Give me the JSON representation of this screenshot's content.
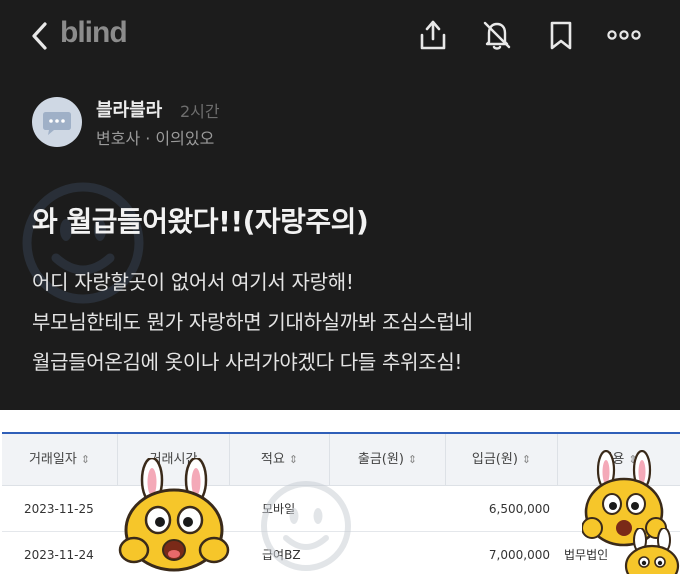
{
  "header": {
    "logo": "blind"
  },
  "post": {
    "author": "블라블라",
    "time": "2시간",
    "meta": "변호사 · 이의있오",
    "title": "와 월급들어왔다!!(자랑주의)",
    "body": [
      "어디 자랑할곳이 없어서 여기서 자랑해!",
      "부모님한테도 뭔가 자랑하면 기대하실까봐 조심스럽네",
      "월급들어온김에 옷이나 사러가야겠다 다들 추위조심!"
    ]
  },
  "table": {
    "headers": [
      "거래일자",
      "거래시간",
      "적요",
      "출금(원)",
      "입금(원)",
      "내용"
    ],
    "rows": [
      {
        "date": "2023-11-25",
        "desc": "모바일",
        "deposit": "6,500,000",
        "content": ""
      },
      {
        "date": "2023-11-24",
        "desc": "급여BZ",
        "deposit": "7,000,000",
        "content": "법무법인"
      }
    ]
  },
  "colors": {
    "dark_bg": "#1c1c1c",
    "table_accent": "#2f5fb8",
    "sticker_yellow": "#f6c62a"
  },
  "icons": [
    "back-icon",
    "share-icon",
    "bell-off-icon",
    "bookmark-icon",
    "more-icon",
    "chat-bubble-icon",
    "sort-icon",
    "smiley-watermark-icon"
  ]
}
